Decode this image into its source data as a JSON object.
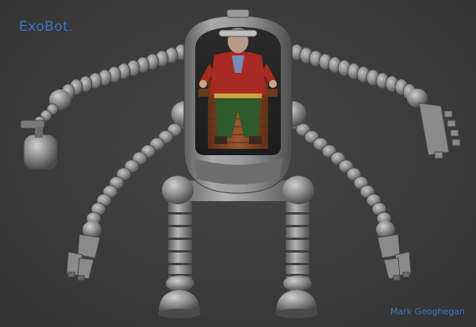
{
  "title": "ExoBot.",
  "credit": "Mark Geoghegan",
  "colors": {
    "background": "#3a3a3a",
    "metal": "#8c8c8c",
    "metal_dark": "#5a5a5a",
    "label_blue": "#3b73c8",
    "pilot_coat": "#a82a22",
    "pilot_trousers": "#2f5a2a",
    "seat_wood": "#8a4a28"
  }
}
